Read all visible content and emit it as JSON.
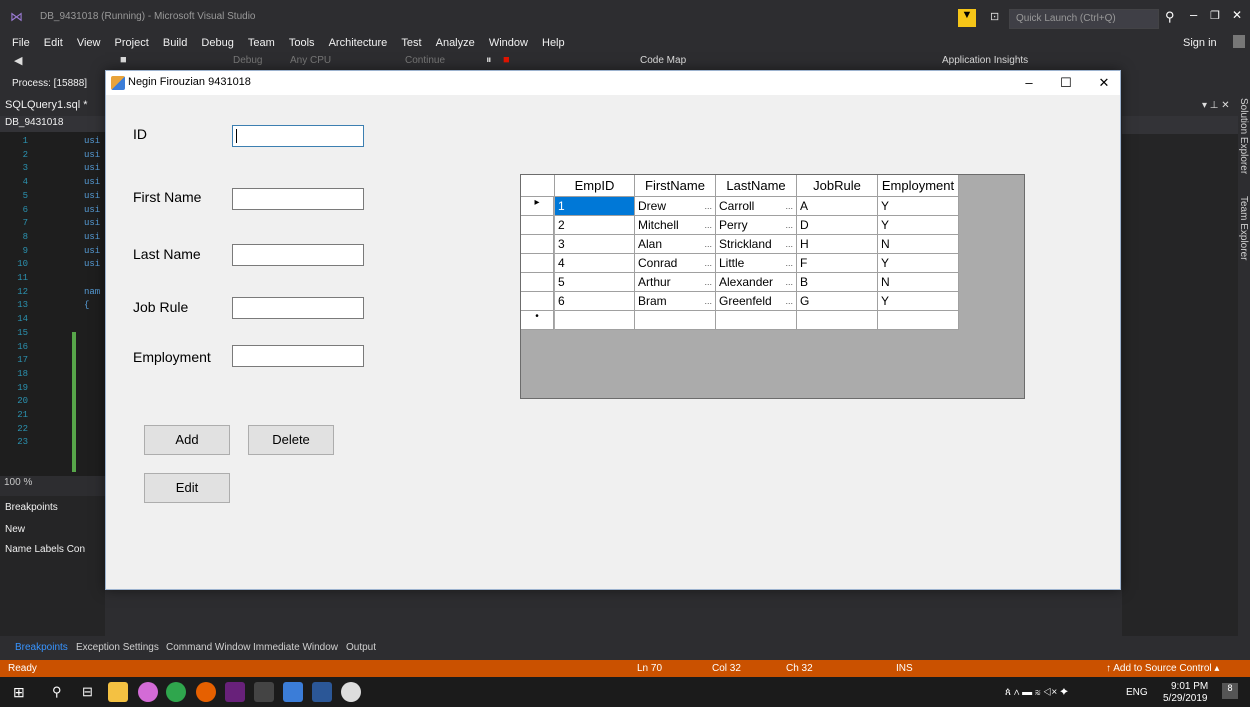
{
  "vs": {
    "title": "DB_9431018 (Running) - Microsoft Visual Studio",
    "quick_launch": "Quick Launch (Ctrl+Q)",
    "sign_in": "Sign in",
    "menu": [
      "File",
      "Edit",
      "View",
      "Project",
      "Build",
      "Debug",
      "Team",
      "Tools",
      "Architecture",
      "Test",
      "Analyze",
      "Window",
      "Help"
    ],
    "toolbar": {
      "debug": "Debug",
      "cpu": "Any CPU",
      "continue": "Continue",
      "code_map": "Code Map",
      "app_insights": "Application Insights"
    },
    "process": "Process: [15888]",
    "editor_tab": "SQLQuery1.sql *",
    "editor_dropdown": "DB_9431018",
    "line_numbers": [
      "1",
      "2",
      "3",
      "4",
      "5",
      "6",
      "7",
      "8",
      "9",
      "10",
      "11",
      "12",
      "13",
      "14",
      "15",
      "16",
      "17",
      "18",
      "19",
      "20",
      "21",
      "22",
      "23"
    ],
    "code_stubs": [
      "usi",
      "usi",
      "usi",
      "usi",
      "usi",
      "usi",
      "usi",
      "usi",
      "usi",
      "usi",
      "",
      "nam",
      "{"
    ],
    "zoom": "100 %",
    "breakpoints_title": "Breakpoints",
    "bp_new": "New",
    "bp_columns": "Name  Labels  Con",
    "side_tabs": [
      "Solution Explorer",
      "Team Explorer"
    ],
    "bottom_tabs": [
      "Breakpoints",
      "Exception Settings",
      "Command Window",
      "Immediate Window",
      "Output"
    ]
  },
  "status": {
    "ready": "Ready",
    "ln": "Ln 70",
    "col": "Col 32",
    "ch": "Ch 32",
    "ins": "INS",
    "source_control": "Add to Source Control"
  },
  "taskbar": {
    "lang": "ENG",
    "time": "9:01 PM",
    "date": "5/29/2019",
    "notif": "8"
  },
  "form": {
    "title": "Negin Firouzian 9431018",
    "labels": {
      "id": "ID",
      "first_name": "First Name",
      "last_name": "Last Name",
      "job_rule": "Job Rule",
      "employment": "Employment"
    },
    "values": {
      "id": "",
      "first_name": "",
      "last_name": "",
      "job_rule": "",
      "employment": ""
    },
    "buttons": {
      "add": "Add",
      "delete": "Delete",
      "edit": "Edit"
    }
  },
  "grid": {
    "columns": [
      "EmpID",
      "FirstName",
      "LastName",
      "JobRule",
      "Employment"
    ],
    "rows": [
      [
        "1",
        "Drew",
        "Carroll",
        "A",
        "Y"
      ],
      [
        "2",
        "Mitchell",
        "Perry",
        "D",
        "Y"
      ],
      [
        "3",
        "Alan",
        "Strickland",
        "H",
        "N"
      ],
      [
        "4",
        "Conrad",
        "Little",
        "F",
        "Y"
      ],
      [
        "5",
        "Arthur",
        "Alexander",
        "B",
        "N"
      ],
      [
        "6",
        "Bram",
        "Greenfeld",
        "G",
        "Y"
      ]
    ]
  },
  "colors": {
    "accent": "#ca5100",
    "selection": "#0078d7",
    "vs_bg": "#2d2d30"
  }
}
